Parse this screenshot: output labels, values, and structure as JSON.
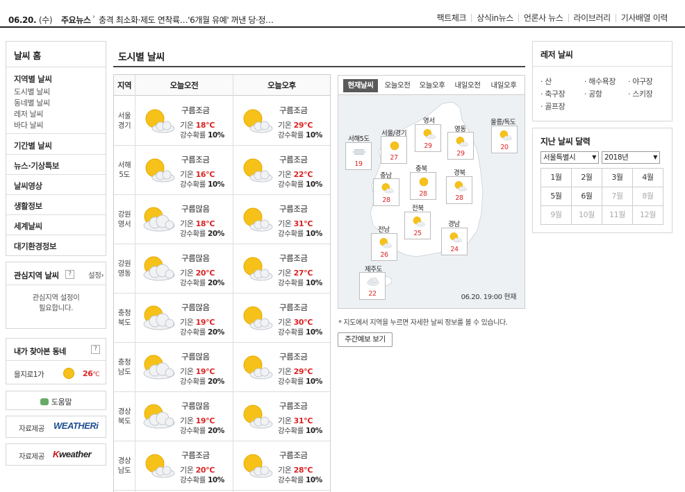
{
  "topbar": {
    "date": "06.20.",
    "dow": "(수)",
    "ticker_label": "주요뉴스",
    "ticker_arrow": "›",
    "ticker_text": "충격 최소화·제도 연착륙…'6개월 유예' 꺼낸 당·정…",
    "links": [
      "팩트체크",
      "상식in뉴스",
      "언론사 뉴스",
      "라이브러리",
      "기사배열 이력"
    ]
  },
  "left_nav": {
    "home": "날씨 홈",
    "group1_title": "지역별 날씨",
    "group1_items": [
      "도시별 날씨",
      "동네별 날씨",
      "레저 날씨",
      "바다 날씨"
    ],
    "main_items": [
      "기간별 날씨",
      "뉴스·기상특보",
      "날씨영상",
      "생활정보",
      "세계날씨",
      "대기환경정보"
    ]
  },
  "favorites": {
    "title": "관심지역 날씨",
    "help": "?",
    "settings": "설정",
    "settings_arrow": "›",
    "msg_line1": "관심지역 설정이",
    "msg_line2": "필요합니다."
  },
  "my_places": {
    "title": "내가 찾아본 동네",
    "help": "?",
    "location": "을지로1가",
    "temp": "26",
    "temp_unit": "℃"
  },
  "help_button": "도움말",
  "providers": [
    {
      "label": "자료제공",
      "logo": "WEATHERi"
    },
    {
      "label": "자료제공",
      "logo_k": "K",
      "logo_rest": "weather"
    }
  ],
  "page_title": "도시별 날씨",
  "table": {
    "col_region": "지역",
    "col_am": "오늘오전",
    "col_pm": "오늘오후",
    "temp_label": "기온",
    "temp_unit": "℃",
    "rain_label": "강수확률",
    "rows": [
      {
        "line1": "서울",
        "line2": "경기",
        "am": {
          "cond": "구름조금",
          "icon": "sun-cloud-icon",
          "temp": "18",
          "rain": "10%"
        },
        "pm": {
          "cond": "구름조금",
          "icon": "sun-cloud-icon",
          "temp": "29",
          "rain": "10%"
        }
      },
      {
        "line1": "서해",
        "line2": "5도",
        "am": {
          "cond": "구름조금",
          "icon": "sun-cloud-icon",
          "temp": "16",
          "rain": "10%"
        },
        "pm": {
          "cond": "구름조금",
          "icon": "sun-cloud-icon",
          "temp": "22",
          "rain": "10%"
        }
      },
      {
        "line1": "강원",
        "line2": "영서",
        "am": {
          "cond": "구름많음",
          "icon": "cloudy-sun-icon",
          "temp": "18",
          "rain": "20%"
        },
        "pm": {
          "cond": "구름조금",
          "icon": "sun-cloud-icon",
          "temp": "31",
          "rain": "10%"
        }
      },
      {
        "line1": "강원",
        "line2": "영동",
        "am": {
          "cond": "구름많음",
          "icon": "cloudy-sun-icon",
          "temp": "20",
          "rain": "20%"
        },
        "pm": {
          "cond": "구름조금",
          "icon": "sun-cloud-icon",
          "temp": "27",
          "rain": "10%"
        }
      },
      {
        "line1": "충청",
        "line2": "북도",
        "am": {
          "cond": "구름많음",
          "icon": "cloudy-sun-icon",
          "temp": "19",
          "rain": "20%"
        },
        "pm": {
          "cond": "구름조금",
          "icon": "sun-cloud-icon",
          "temp": "30",
          "rain": "10%"
        }
      },
      {
        "line1": "충청",
        "line2": "남도",
        "am": {
          "cond": "구름많음",
          "icon": "cloudy-sun-icon",
          "temp": "19",
          "rain": "20%"
        },
        "pm": {
          "cond": "구름조금",
          "icon": "sun-cloud-icon",
          "temp": "29",
          "rain": "10%"
        }
      },
      {
        "line1": "경상",
        "line2": "북도",
        "am": {
          "cond": "구름많음",
          "icon": "cloudy-sun-icon",
          "temp": "19",
          "rain": "20%"
        },
        "pm": {
          "cond": "구름조금",
          "icon": "sun-cloud-icon",
          "temp": "31",
          "rain": "10%"
        }
      },
      {
        "line1": "경상",
        "line2": "남도",
        "am": {
          "cond": "구름조금",
          "icon": "sun-cloud-icon",
          "temp": "20",
          "rain": "10%"
        },
        "pm": {
          "cond": "구름조금",
          "icon": "sun-cloud-icon",
          "temp": "28",
          "rain": "10%"
        }
      }
    ]
  },
  "map": {
    "tabs": [
      "현재날씨",
      "오늘오전",
      "오늘오후",
      "내일오전",
      "내일오후"
    ],
    "active_tab": "현재날씨",
    "cities": [
      {
        "name": "서해5도",
        "temp": "19",
        "icon": "fog-icon"
      },
      {
        "name": "서울/경기",
        "temp": "27",
        "icon": "sun-icon"
      },
      {
        "name": "영서",
        "temp": "29",
        "icon": "sun-cloud-icon"
      },
      {
        "name": "영동",
        "temp": "29",
        "icon": "sun-cloud-icon"
      },
      {
        "name": "울릉/독도",
        "temp": "20",
        "icon": "sun-cloud-icon"
      },
      {
        "name": "충남",
        "temp": "28",
        "icon": "sun-cloud-icon"
      },
      {
        "name": "충북",
        "temp": "28",
        "icon": "sun-icon"
      },
      {
        "name": "경북",
        "temp": "28",
        "icon": "sun-cloud-icon"
      },
      {
        "name": "전북",
        "temp": "25",
        "icon": "sun-cloud-icon"
      },
      {
        "name": "전남",
        "temp": "26",
        "icon": "sun-cloud-icon"
      },
      {
        "name": "경남",
        "temp": "24",
        "icon": "sun-cloud-icon"
      },
      {
        "name": "제주도",
        "temp": "22",
        "icon": "cloud-icon"
      }
    ],
    "timestamp": "06.20. 19:00 현재",
    "note": "* 지도에서 지역을 누르면 자세한 날씨 정보를 볼 수 있습니다.",
    "week_button": "주간예보 보기"
  },
  "leisure": {
    "title": "레저 날씨",
    "items": [
      "산",
      "해수욕장",
      "야구장",
      "축구장",
      "공항",
      "스키장",
      "골프장"
    ]
  },
  "calendar": {
    "title": "지난 날씨 달력",
    "region": "서울특별시",
    "year": "2018년",
    "months": [
      "1월",
      "2월",
      "3월",
      "4월",
      "5월",
      "6월",
      "7월",
      "8월",
      "9월",
      "10월",
      "11월",
      "12월"
    ],
    "enabled_months": 6
  },
  "colors": {
    "temp_red": "#d22222",
    "tab_active": "#595959",
    "accent_dark": "#222222"
  }
}
